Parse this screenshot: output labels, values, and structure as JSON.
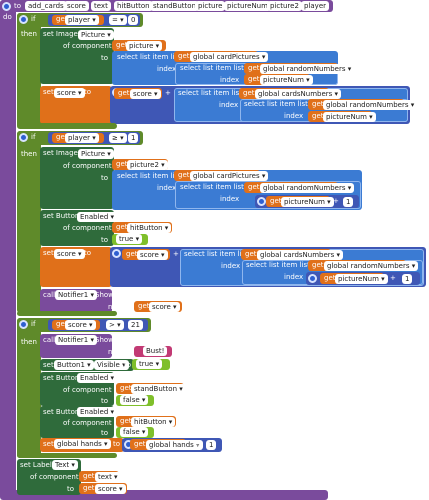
{
  "header": {
    "to_label": "to",
    "proc_name": "add_cards",
    "params": [
      "score",
      "text",
      "hitButton",
      "standButton",
      "picture",
      "pictureNum",
      "picture2",
      "player"
    ],
    "do_label": "do"
  },
  "kw": {
    "if": "if",
    "then": "then",
    "get": "get",
    "set_image": "set Image.",
    "set_button": "set Button.",
    "set_label": "set Label.",
    "of_component": "of component",
    "to": "to",
    "select_list_item": "select list item  list",
    "index": "index",
    "call": "call",
    "notice": "notice",
    "set": "set"
  },
  "props": {
    "picture": "Picture",
    "enabled": "Enabled",
    "visible": "Visible",
    "text": "Text",
    "notifier": "Notifier1",
    "show_alert": "ShowAlert",
    "button1": "Button1"
  },
  "ops": {
    "eq": "=",
    "gte": "≥",
    "gt": ">",
    "plus": "+"
  },
  "vars": {
    "player": "player",
    "picture": "picture",
    "picture2": "picture2",
    "score": "score",
    "text": "text",
    "hitButton": "hitButton",
    "standButton": "standButton",
    "pictureNum": "pictureNum",
    "card_pictures": "global cardPictures",
    "card_numbers": "global cardsNumbers",
    "random_numbers": "global randomNumbers",
    "hands": "global hands"
  },
  "values": {
    "zero": "0",
    "one": "1",
    "twentyone": "21",
    "false_val": "false",
    "true_val": "true",
    "bust": "Bust!"
  }
}
